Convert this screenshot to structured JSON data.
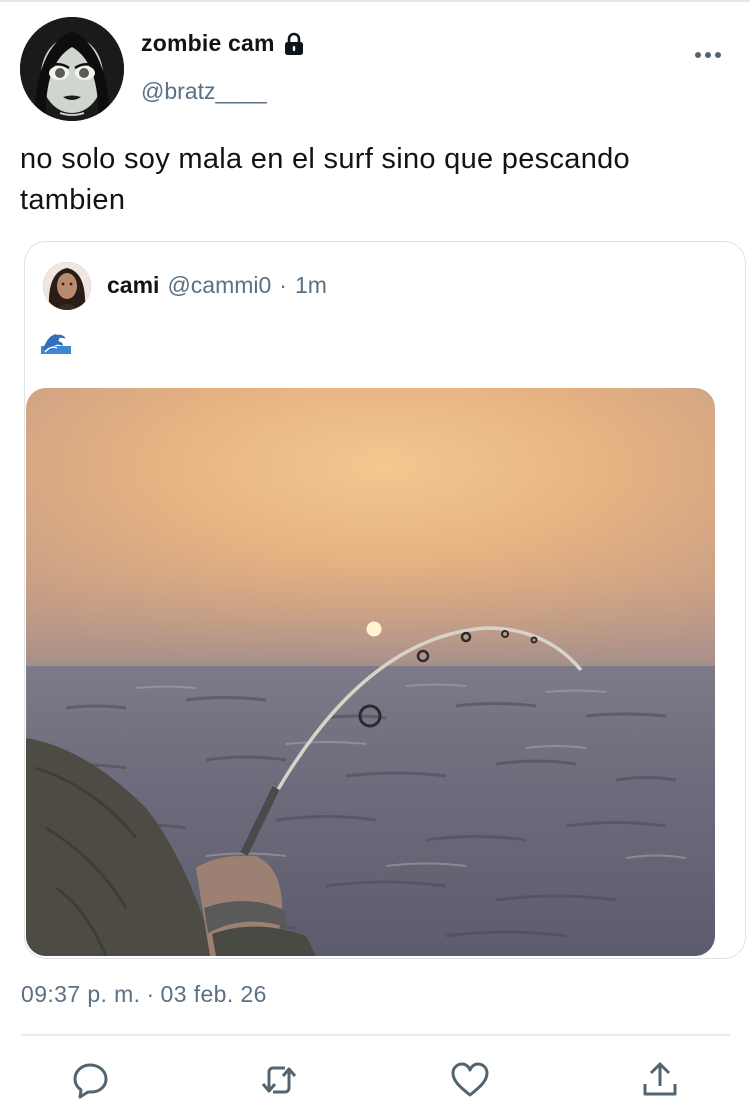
{
  "tweet": {
    "author": {
      "display_name": "zombie cam",
      "handle": "@bratz____",
      "locked_icon": "lock-icon",
      "avatar": "avatar"
    },
    "text": "no solo soy mala en el surf sino que pescando tambien",
    "timestamp": {
      "time": "09:37 p. m.",
      "separator": "·",
      "date": "03 feb. 26"
    }
  },
  "quoted_tweet": {
    "author": {
      "display_name": "cami",
      "handle": "@cammi0",
      "avatar": "avatar"
    },
    "separator": "·",
    "time_ago": "1m",
    "text_emoji": "wave-icon"
  },
  "actions": [
    {
      "name": "reply",
      "icon": "reply-icon"
    },
    {
      "name": "retweet",
      "icon": "retweet-icon"
    },
    {
      "name": "like",
      "icon": "heart-icon"
    },
    {
      "name": "share",
      "icon": "share-icon"
    }
  ],
  "colors": {
    "text_primary": "#0f1419",
    "text_secondary": "#5b7083",
    "border": "#dde3e7",
    "icon": "#536471"
  }
}
